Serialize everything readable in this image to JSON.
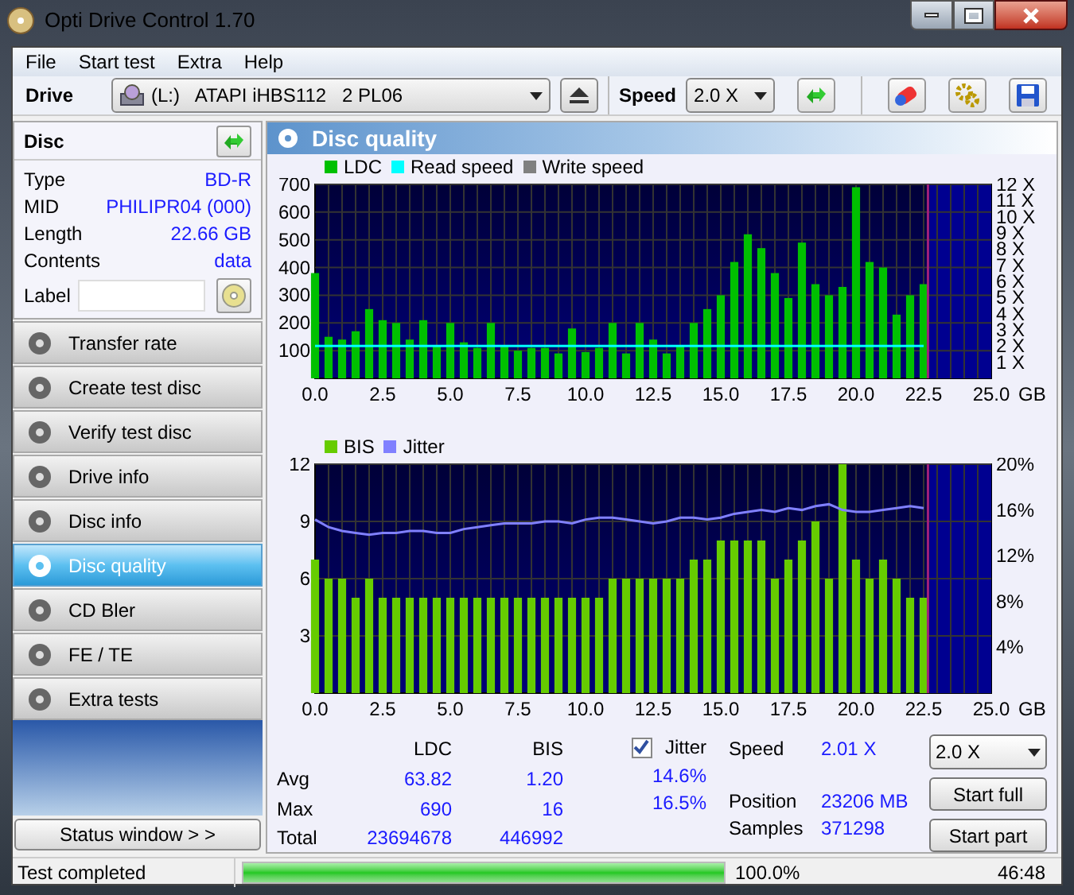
{
  "window": {
    "title": "Opti Drive Control 1.70"
  },
  "menu": [
    "File",
    "Start test",
    "Extra",
    "Help"
  ],
  "toolbar": {
    "drive_label": "Drive",
    "drive": "(L:)   ATAPI iHBS112   2 PL06",
    "speed_label": "Speed",
    "speed": "2.0 X"
  },
  "disc": {
    "title": "Disc",
    "rows": [
      {
        "label": "Type",
        "value": "BD-R"
      },
      {
        "label": "MID",
        "value": "PHILIPR04 (000)"
      },
      {
        "label": "Length",
        "value": "22.66 GB"
      },
      {
        "label": "Contents",
        "value": "data"
      }
    ],
    "label_field": "Label"
  },
  "nav": [
    {
      "label": "Transfer rate",
      "selected": false
    },
    {
      "label": "Create test disc",
      "selected": false
    },
    {
      "label": "Verify test disc",
      "selected": false
    },
    {
      "label": "Drive info",
      "selected": false
    },
    {
      "label": "Disc info",
      "selected": false
    },
    {
      "label": "Disc quality",
      "selected": true
    },
    {
      "label": "CD Bler",
      "selected": false
    },
    {
      "label": "FE / TE",
      "selected": false
    },
    {
      "label": "Extra tests",
      "selected": false
    }
  ],
  "status_window_button": "Status window > >",
  "panel_title": "Disc quality",
  "chart_top": {
    "right_axis": [
      "12 X",
      "11 X",
      "10 X",
      "9 X",
      "8 X",
      "7 X",
      "6 X",
      "5 X",
      "4 X",
      "3 X",
      "2 X",
      "1 X"
    ],
    "chart_data": {
      "type": "bar",
      "xlabel": "GB",
      "x": [
        0,
        0.5,
        1,
        1.5,
        2,
        2.5,
        3,
        3.5,
        4,
        4.5,
        5,
        5.5,
        6,
        6.5,
        7,
        7.5,
        8,
        8.5,
        9,
        9.5,
        10,
        10.5,
        11,
        11.5,
        12,
        12.5,
        13,
        13.5,
        14,
        14.5,
        15,
        15.5,
        16,
        16.5,
        17,
        17.5,
        18,
        18.5,
        19,
        19.5,
        20,
        20.5,
        21,
        21.5,
        22,
        22.5
      ],
      "series": [
        {
          "name": "LDC",
          "color": "#00c000",
          "values": [
            380,
            150,
            140,
            170,
            250,
            210,
            200,
            140,
            210,
            120,
            200,
            130,
            110,
            200,
            120,
            100,
            110,
            110,
            90,
            180,
            95,
            110,
            200,
            90,
            200,
            140,
            90,
            120,
            200,
            250,
            300,
            420,
            520,
            470,
            380,
            290,
            490,
            340,
            300,
            330,
            690,
            420,
            400,
            230,
            300,
            340
          ]
        },
        {
          "name": "Read speed",
          "color": "#00ffff",
          "type": "line",
          "values": [
            117,
            117,
            117,
            117,
            117,
            117,
            117,
            117,
            117,
            117,
            117,
            117,
            117,
            117,
            117,
            117,
            117,
            117,
            117,
            117,
            117,
            117,
            117,
            117,
            117,
            117,
            117,
            117,
            117,
            117,
            117,
            117,
            117,
            117,
            117,
            117,
            117,
            117,
            117,
            117,
            117,
            117,
            117,
            117,
            117,
            117
          ]
        },
        {
          "name": "Write speed",
          "color": "#808080",
          "type": "line",
          "values": [
            null,
            null,
            null,
            null,
            null,
            null,
            null,
            null,
            null,
            null,
            null,
            null,
            null,
            null,
            null,
            null,
            null,
            null,
            null,
            null,
            null,
            null,
            null,
            null,
            null,
            null,
            null,
            null,
            null,
            null,
            null,
            null,
            null,
            null,
            null,
            null,
            null,
            null,
            null,
            null,
            null,
            null,
            null,
            null,
            null,
            null
          ]
        }
      ],
      "xlim": [
        0,
        25
      ],
      "ylim": [
        0,
        700
      ],
      "xticks": [
        {
          "value": 0,
          "label": "0.0"
        },
        {
          "value": 2.5,
          "label": "2.5"
        },
        {
          "value": 5,
          "label": "5.0"
        },
        {
          "value": 7.5,
          "label": "7.5"
        },
        {
          "value": 10,
          "label": "10.0"
        },
        {
          "value": 12.5,
          "label": "12.5"
        },
        {
          "value": 15,
          "label": "15.0"
        },
        {
          "value": 17.5,
          "label": "17.5"
        },
        {
          "value": 20,
          "label": "20.0"
        },
        {
          "value": 22.5,
          "label": "22.5"
        },
        {
          "value": 25,
          "label": "25.0"
        }
      ],
      "yticks": [
        100,
        200,
        300,
        400,
        500,
        600,
        700
      ],
      "grid": true,
      "ref_lines": [
        {
          "axis": "x",
          "value": 22.66,
          "color": "#a0207a"
        }
      ],
      "bands": [
        {
          "axis": "x",
          "from": 22.66,
          "to": 25,
          "color": "#000090"
        }
      ]
    }
  },
  "chart_bottom": {
    "right_axis": [
      "20%",
      "16%",
      "12%",
      "8%",
      "4%"
    ],
    "chart_data": {
      "type": "bar",
      "xlabel": "GB",
      "x": [
        0,
        0.5,
        1,
        1.5,
        2,
        2.5,
        3,
        3.5,
        4,
        4.5,
        5,
        5.5,
        6,
        6.5,
        7,
        7.5,
        8,
        8.5,
        9,
        9.5,
        10,
        10.5,
        11,
        11.5,
        12,
        12.5,
        13,
        13.5,
        14,
        14.5,
        15,
        15.5,
        16,
        16.5,
        17,
        17.5,
        18,
        18.5,
        19,
        19.5,
        20,
        20.5,
        21,
        21.5,
        22,
        22.5
      ],
      "series": [
        {
          "name": "BIS",
          "color": "#66cc00",
          "values": [
            7,
            6,
            6,
            5,
            6,
            5,
            5,
            5,
            5,
            5,
            5,
            5,
            5,
            5,
            5,
            5,
            5,
            5,
            5,
            5,
            5,
            5,
            6,
            6,
            6,
            6,
            6,
            6,
            7,
            7,
            8,
            8,
            8,
            8,
            6,
            7,
            8,
            9,
            6,
            12,
            7,
            6,
            7,
            6,
            5,
            5
          ]
        },
        {
          "name": "Jitter",
          "color": "#8080ff",
          "type": "line",
          "values": [
            9.1,
            8.7,
            8.5,
            8.4,
            8.3,
            8.4,
            8.4,
            8.5,
            8.5,
            8.4,
            8.4,
            8.6,
            8.7,
            8.8,
            8.9,
            8.9,
            8.9,
            9.0,
            9.0,
            8.9,
            9.1,
            9.2,
            9.2,
            9.1,
            9.0,
            8.9,
            9.0,
            9.2,
            9.2,
            9.1,
            9.2,
            9.4,
            9.5,
            9.6,
            9.5,
            9.7,
            9.6,
            9.8,
            9.9,
            9.6,
            9.5,
            9.5,
            9.6,
            9.7,
            9.8,
            9.7
          ]
        }
      ],
      "xlim": [
        0,
        25
      ],
      "ylim": [
        0,
        12
      ],
      "xticks": [
        {
          "value": 0,
          "label": "0.0"
        },
        {
          "value": 2.5,
          "label": "2.5"
        },
        {
          "value": 5,
          "label": "5.0"
        },
        {
          "value": 7.5,
          "label": "7.5"
        },
        {
          "value": 10,
          "label": "10.0"
        },
        {
          "value": 12.5,
          "label": "12.5"
        },
        {
          "value": 15,
          "label": "15.0"
        },
        {
          "value": 17.5,
          "label": "17.5"
        },
        {
          "value": 20,
          "label": "20.0"
        },
        {
          "value": 22.5,
          "label": "22.5"
        },
        {
          "value": 25,
          "label": "25.0"
        }
      ],
      "yticks": [
        3,
        6,
        9,
        12
      ],
      "grid": true,
      "ref_lines": [
        {
          "axis": "x",
          "value": 22.66,
          "color": "#a0207a"
        }
      ],
      "bands": [
        {
          "axis": "x",
          "from": 22.66,
          "to": 25,
          "color": "#000090"
        }
      ]
    }
  },
  "stats": {
    "columns": [
      "LDC",
      "BIS"
    ],
    "rows": [
      {
        "label": "Avg",
        "ldc": "63.82",
        "bis": "1.20",
        "jitter": "14.6%"
      },
      {
        "label": "Max",
        "ldc": "690",
        "bis": "16",
        "jitter": "16.5%"
      },
      {
        "label": "Total",
        "ldc": "23694678",
        "bis": "446992"
      }
    ],
    "jitter_checkbox": {
      "label": "Jitter",
      "checked": true
    },
    "info": [
      {
        "label": "Speed",
        "value": "2.01 X"
      },
      {
        "label": "Position",
        "value": "23206 MB"
      },
      {
        "label": "Samples",
        "value": "371298"
      }
    ],
    "speed_select": "2.0 X",
    "buttons": [
      "Start full",
      "Start part"
    ]
  },
  "status_bar": {
    "message": "Test completed",
    "progress": {
      "level": 1.0
    },
    "percent": "100.0%",
    "time": "46:48"
  }
}
